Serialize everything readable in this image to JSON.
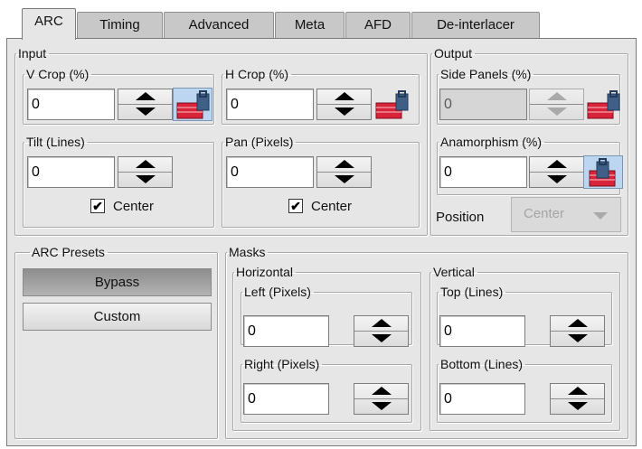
{
  "tabs": [
    {
      "label": "ARC",
      "active": true
    },
    {
      "label": "Timing",
      "active": false
    },
    {
      "label": "Advanced",
      "active": false
    },
    {
      "label": "Meta",
      "active": false
    },
    {
      "label": "AFD",
      "active": false
    },
    {
      "label": "De-interlacer",
      "active": false
    }
  ],
  "input": {
    "legend": "Input",
    "v_crop": {
      "legend": "V Crop (%)",
      "value": "0"
    },
    "h_crop": {
      "legend": "H Crop (%)",
      "value": "0"
    },
    "tilt": {
      "legend": "Tilt (Lines)",
      "value": "0",
      "center_label": "Center",
      "center_checked": true
    },
    "pan": {
      "legend": "Pan (Pixels)",
      "value": "0",
      "center_label": "Center",
      "center_checked": true
    }
  },
  "output": {
    "legend": "Output",
    "side_panels": {
      "legend": "Side Panels (%)",
      "value": "0",
      "disabled": true
    },
    "anamorphism": {
      "legend": "Anamorphism (%)",
      "value": "0"
    },
    "position_label": "Position",
    "position_value": "Center",
    "check_mark": "✔"
  },
  "arc_presets": {
    "legend": "ARC Presets",
    "buttons": [
      "Bypass",
      "Custom"
    ],
    "selected": "Bypass"
  },
  "masks": {
    "legend": "Masks",
    "horizontal": {
      "legend": "Horizontal",
      "left": {
        "legend": "Left (Pixels)",
        "value": "0"
      },
      "right": {
        "legend": "Right (Pixels)",
        "value": "0"
      }
    },
    "vertical": {
      "legend": "Vertical",
      "top": {
        "legend": "Top (Lines)",
        "value": "0"
      },
      "bottom": {
        "legend": "Bottom (Lines)",
        "value": "0"
      }
    }
  },
  "colors": {
    "panel_bg": "#e6e6e6",
    "tab_inactive": "#c8c8c8",
    "lock_highlight": "#bcd6f2",
    "lock_red": "#d9233a",
    "selected_button": "#9d9d9d"
  }
}
